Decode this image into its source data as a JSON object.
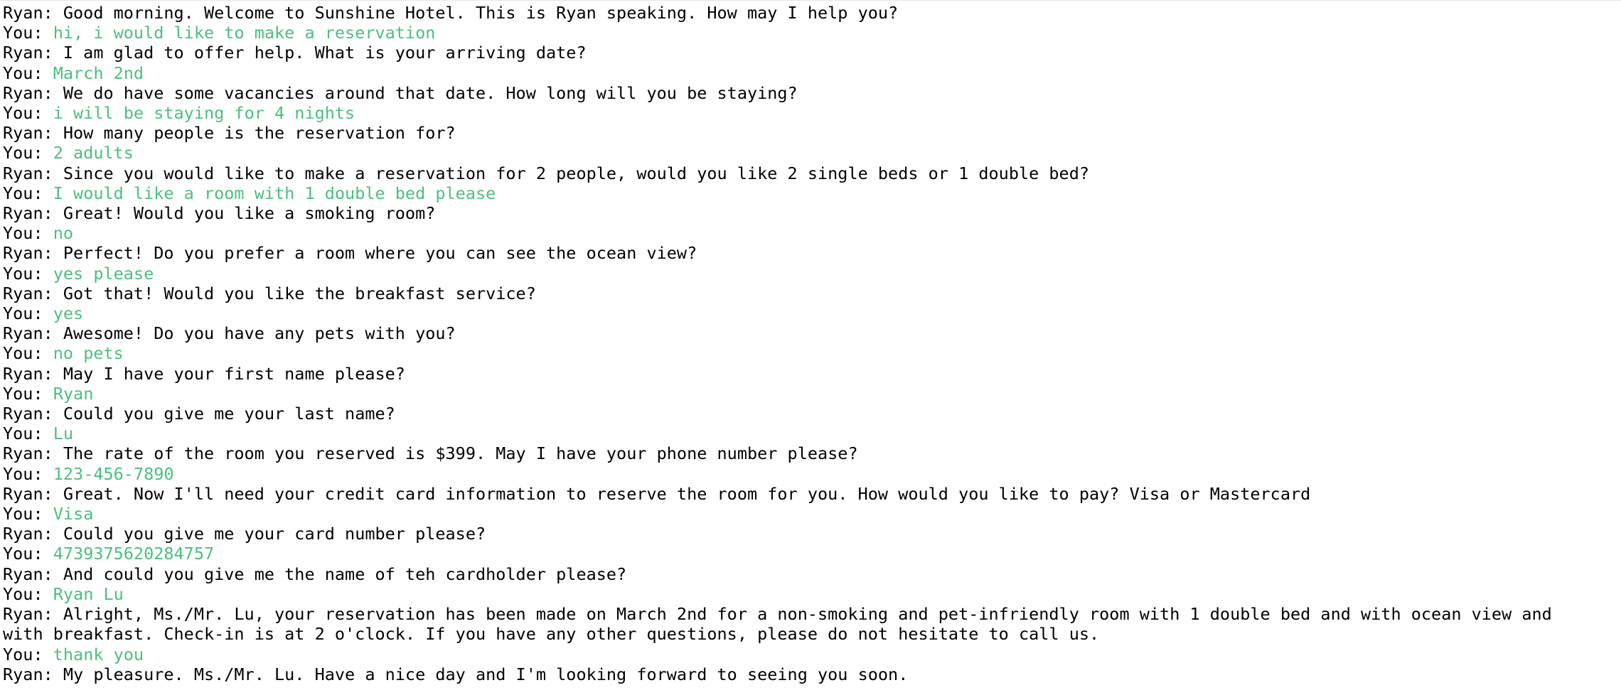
{
  "colors": {
    "background": "#ffffff",
    "agent_text": "#000000",
    "user_text": "#4cbf7e"
  },
  "conversation": [
    {
      "speaker": "Ryan: ",
      "role": "agent",
      "text": "Good morning. Welcome to Sunshine Hotel. This is Ryan speaking. How may I help you?"
    },
    {
      "speaker": "You: ",
      "role": "user",
      "text": "hi, i would like to make a reservation"
    },
    {
      "speaker": "Ryan: ",
      "role": "agent",
      "text": "I am glad to offer help. What is your arriving date?"
    },
    {
      "speaker": "You: ",
      "role": "user",
      "text": "March 2nd"
    },
    {
      "speaker": "Ryan: ",
      "role": "agent",
      "text": "We do have some vacancies around that date. How long will you be staying?"
    },
    {
      "speaker": "You: ",
      "role": "user",
      "text": "i will be staying for 4 nights"
    },
    {
      "speaker": "Ryan: ",
      "role": "agent",
      "text": "How many people is the reservation for?"
    },
    {
      "speaker": "You: ",
      "role": "user",
      "text": "2 adults"
    },
    {
      "speaker": "Ryan: ",
      "role": "agent",
      "text": "Since you would like to make a reservation for 2 people, would you like 2 single beds or 1 double bed?"
    },
    {
      "speaker": "You: ",
      "role": "user",
      "text": "I would like a room with 1 double bed please"
    },
    {
      "speaker": "Ryan: ",
      "role": "agent",
      "text": "Great! Would you like a smoking room?"
    },
    {
      "speaker": "You: ",
      "role": "user",
      "text": "no"
    },
    {
      "speaker": "Ryan: ",
      "role": "agent",
      "text": "Perfect! Do you prefer a room where you can see the ocean view?"
    },
    {
      "speaker": "You: ",
      "role": "user",
      "text": "yes please"
    },
    {
      "speaker": "Ryan: ",
      "role": "agent",
      "text": "Got that! Would you like the breakfast service?"
    },
    {
      "speaker": "You: ",
      "role": "user",
      "text": "yes"
    },
    {
      "speaker": "Ryan: ",
      "role": "agent",
      "text": "Awesome! Do you have any pets with you?"
    },
    {
      "speaker": "You: ",
      "role": "user",
      "text": "no pets"
    },
    {
      "speaker": "Ryan: ",
      "role": "agent",
      "text": "May I have your first name please?"
    },
    {
      "speaker": "You: ",
      "role": "user",
      "text": "Ryan"
    },
    {
      "speaker": "Ryan: ",
      "role": "agent",
      "text": "Could you give me your last name?"
    },
    {
      "speaker": "You: ",
      "role": "user",
      "text": "Lu"
    },
    {
      "speaker": "Ryan: ",
      "role": "agent",
      "text": "The rate of the room you reserved is $399. May I have your phone number please?"
    },
    {
      "speaker": "You: ",
      "role": "user",
      "text": "123-456-7890"
    },
    {
      "speaker": "Ryan: ",
      "role": "agent",
      "text": "Great. Now I'll need your credit card information to reserve the room for you. How would you like to pay? Visa or Mastercard"
    },
    {
      "speaker": "You: ",
      "role": "user",
      "text": "Visa"
    },
    {
      "speaker": "Ryan: ",
      "role": "agent",
      "text": "Could you give me your card number please?"
    },
    {
      "speaker": "You: ",
      "role": "user",
      "text": "4739375620284757"
    },
    {
      "speaker": "Ryan: ",
      "role": "agent",
      "text": "And could you give me the name of teh cardholder please?"
    },
    {
      "speaker": "You: ",
      "role": "user",
      "text": "Ryan Lu"
    },
    {
      "speaker": "Ryan: ",
      "role": "agent",
      "text": "Alright, Ms./Mr. Lu, your reservation has been made on March 2nd for a non-smoking and pet-infriendly room with 1 double bed and with ocean view and with breakfast. Check-in is at 2 o'clock. If you have any other questions, please do not hesitate to call us."
    },
    {
      "speaker": "You: ",
      "role": "user",
      "text": "thank you"
    },
    {
      "speaker": "Ryan: ",
      "role": "agent",
      "text": "My pleasure. Ms./Mr. Lu. Have a nice day and I'm looking forward to seeing you soon."
    }
  ]
}
